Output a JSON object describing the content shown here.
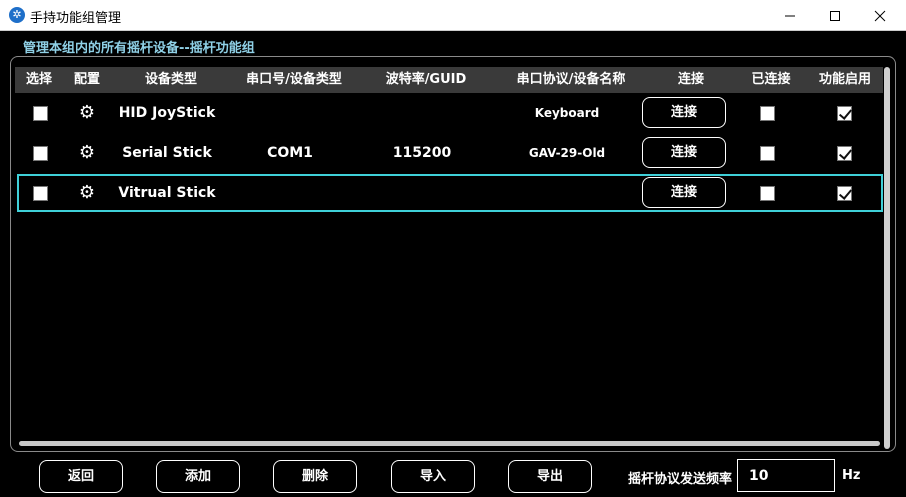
{
  "window": {
    "title": "手持功能组管理",
    "icon": "app-logo-icon",
    "controls": [
      "minimize-icon",
      "maximize-icon",
      "close-icon"
    ]
  },
  "heading": "管理本组内的所有摇杆设备--摇杆功能组",
  "table": {
    "columns": [
      "选择",
      "配置",
      "设备类型",
      "串口号/设备类型",
      "波特率/GUID",
      "串口协议/设备名称",
      "连接",
      "已连接",
      "功能启用"
    ],
    "rows": [
      {
        "selected": false,
        "config_icon": "gear-icon",
        "device_type": "HID JoyStick",
        "port": "",
        "baud": "",
        "protocol": "Keyboard",
        "connect_label": "连接",
        "connected": false,
        "enabled": true
      },
      {
        "selected": false,
        "config_icon": "gear-icon",
        "device_type": "Serial Stick",
        "port": "COM1",
        "baud": "115200",
        "protocol": "GAV-29-Old",
        "connect_label": "连接",
        "connected": false,
        "enabled": true
      },
      {
        "selected": false,
        "config_icon": "gear-icon",
        "device_type": "Vitrual Stick",
        "port": "",
        "baud": "",
        "protocol": "",
        "connect_label": "连接",
        "connected": false,
        "enabled": true
      }
    ],
    "highlight_color": "#3fd0d8",
    "header_bg": "#3a3a3a"
  },
  "footer": {
    "back_label": "返回",
    "add_label": "添加",
    "delete_label": "删除",
    "import_label": "导入",
    "export_label": "导出",
    "frequency_label": "摇杆协议发送频率",
    "frequency_value": "10",
    "frequency_unit": "Hz"
  }
}
